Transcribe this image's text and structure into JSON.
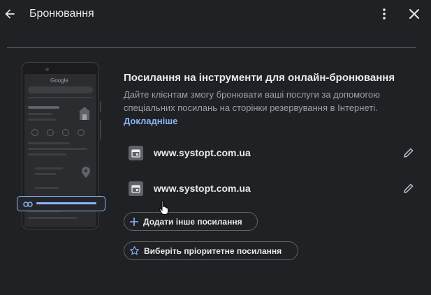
{
  "header": {
    "title": "Бронювання",
    "back_icon": "arrow-back-icon",
    "more_icon": "more-vert-icon",
    "close_icon": "close-icon"
  },
  "illustration": {
    "search_brand": "Google"
  },
  "section": {
    "heading": "Посилання на інструменти для онлайн-бронювання",
    "description": "Дайте клієнтам змогу бронювати ваші послуги за допомогою спеціальних посилань на сторінки резервування в Інтернеті.",
    "learn_more": "Докладніше"
  },
  "links": [
    {
      "url": "www.systopt.com.ua",
      "icon": "calendar-icon",
      "edit_icon": "edit-pencil-icon"
    },
    {
      "url": "www.systopt.com.ua",
      "icon": "calendar-icon",
      "edit_icon": "edit-pencil-icon"
    }
  ],
  "actions": {
    "add_link": "Додати інше посилання",
    "choose_priority": "Виберіть пріоритетне посилання"
  },
  "colors": {
    "background": "#202124",
    "accent": "#8ab4f8",
    "text_primary": "#e8eaed",
    "text_secondary": "#9aa0a6",
    "border": "#5f6368"
  }
}
